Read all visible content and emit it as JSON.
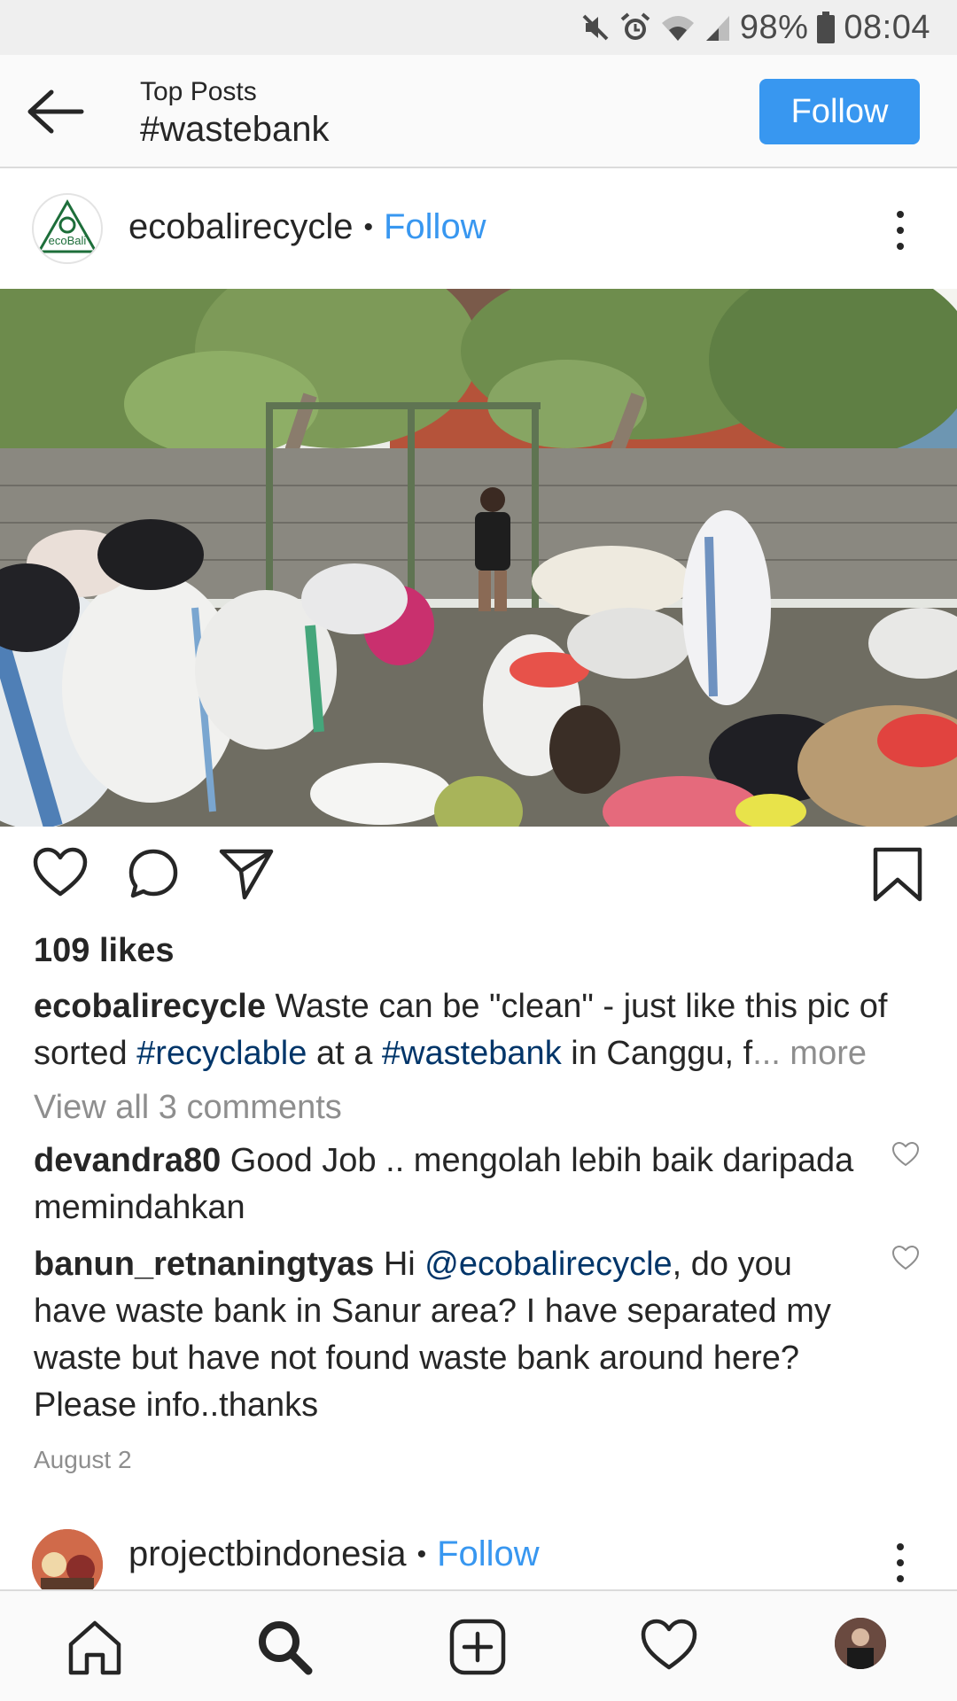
{
  "status_bar": {
    "battery": "98%",
    "time": "08:04",
    "icons": [
      "mute-icon",
      "alarm-icon",
      "wifi-icon",
      "signal-icon",
      "battery-icon"
    ]
  },
  "header": {
    "subtitle": "Top Posts",
    "title": "#wastebank",
    "follow_label": "Follow",
    "accent_color": "#3897f0"
  },
  "post": {
    "username": "ecobalirecycle",
    "dot": "•",
    "follow_label": "Follow",
    "avatar_text": "ecoBali",
    "likes": "109 likes",
    "caption": {
      "username": "ecobalirecycle",
      "text_1": " Waste can be \"clean\" - just like this pic of sorted ",
      "tag_1": "#recyclable",
      "text_2": " at a ",
      "tag_2": "#wastebank",
      "text_3": " in Canggu, f",
      "more": "... more"
    },
    "view_all": "View all 3 comments",
    "comments": [
      {
        "username": "devandra80",
        "text": " Good Job .. mengolah lebih baik daripada memindahkan"
      },
      {
        "username": "banun_retnaningtyas",
        "text_1": " Hi ",
        "mention": "@ecobalirecycle",
        "text_2": ", do you have waste bank in Sanur area? I have separated my waste but have not found waste bank around here? Please info..thanks"
      }
    ],
    "date": "August 2"
  },
  "next_post": {
    "username": "projectbindonesia",
    "dot": "•",
    "follow_label": "Follow"
  },
  "bottom_nav": [
    "home-icon",
    "search-icon",
    "add-post-icon",
    "activity-heart-icon",
    "profile-avatar"
  ]
}
